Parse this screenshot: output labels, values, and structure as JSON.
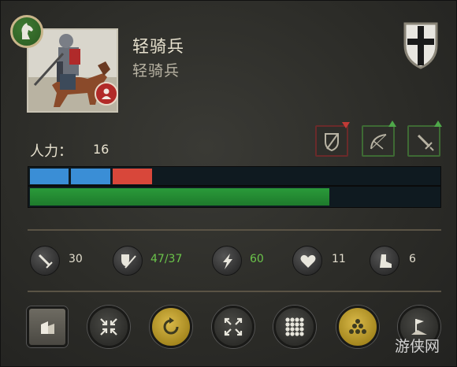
{
  "unit": {
    "name": "轻骑兵",
    "type": "轻骑兵",
    "portrait_icon": "mounted-knight-portrait",
    "class_icon": "horse-head-icon",
    "culture_icon": "person-icon",
    "faction_icon": "black-cross-shield-icon"
  },
  "manpower": {
    "label": "人力：",
    "value": "16"
  },
  "traits": [
    {
      "name": "shield-break",
      "trend": "down"
    },
    {
      "name": "bow",
      "trend": "up"
    },
    {
      "name": "sword",
      "trend": "up"
    }
  ],
  "bars": {
    "blue_segments": 2,
    "red_segments": 1,
    "health_fraction": 0.73
  },
  "stats": {
    "attack": "30",
    "defense": "47/37",
    "charge": "60",
    "morale": "11",
    "speed": "6"
  },
  "buttons": [
    "formation",
    "contract",
    "rotate",
    "expand",
    "square-formation",
    "pyramid-formation",
    "rally-flag"
  ],
  "watermark": "游侠网",
  "colors": {
    "positive": "#6bc44a",
    "blue_segment": "#3a8ed6",
    "red_segment": "#d8473a",
    "health": "#2a9a3a",
    "gold_button": "#c9a533"
  }
}
